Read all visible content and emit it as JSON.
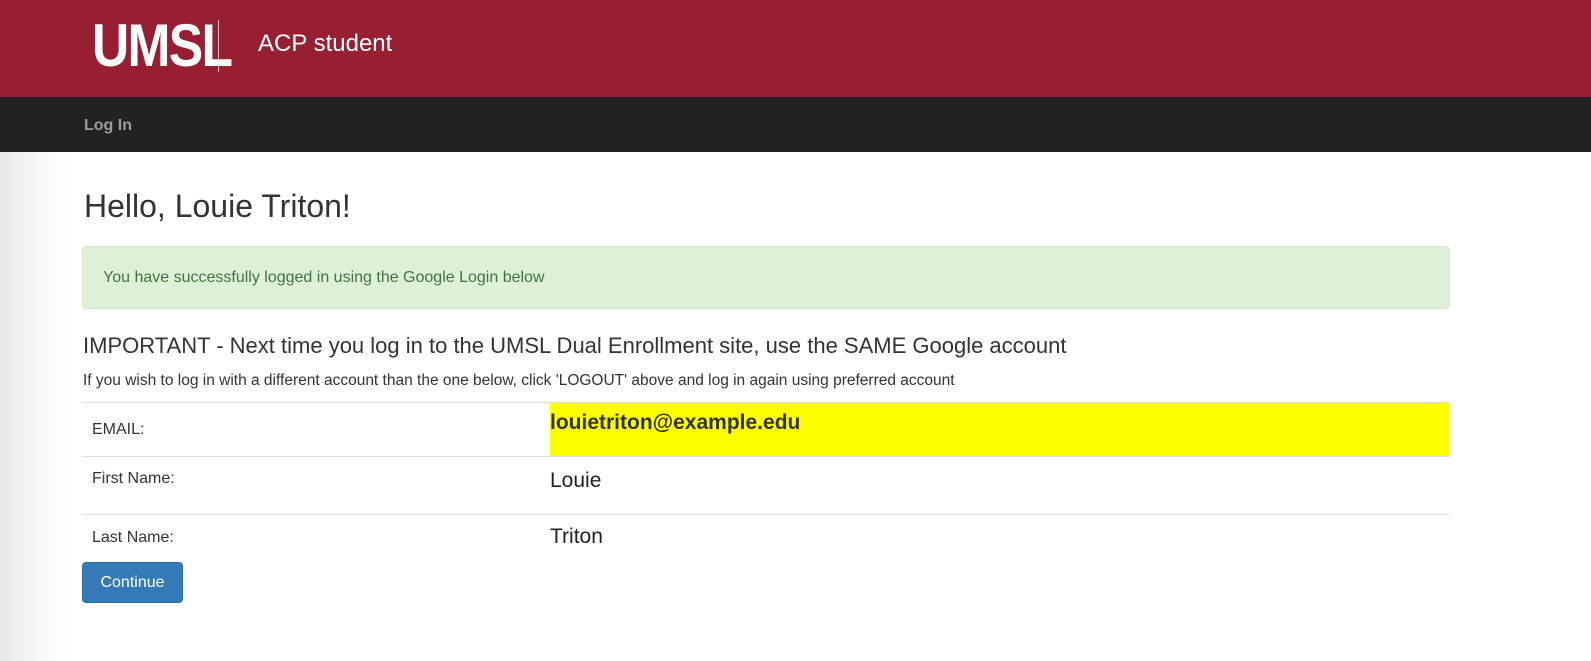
{
  "header": {
    "logo_text": "UMSL",
    "app_title": "ACP student",
    "background_color": "#981e32"
  },
  "navbar": {
    "login_label": "Log In",
    "background_color": "#222222"
  },
  "main": {
    "greeting": "Hello, Louie Triton!",
    "alert_message": "You have successfully logged in using the Google Login below",
    "important_heading": "IMPORTANT - Next time you log in to the UMSL Dual Enrollment site, use the SAME Google account",
    "instruction": "If you wish to log in with a different account than the one below, click 'LOGOUT' above and log in again using preferred account",
    "info_table": {
      "email_label": "EMAIL:",
      "email_value": "louietriton@example.edu",
      "first_name_label": "First Name:",
      "first_name_value": "Louie",
      "last_name_label": "Last Name:",
      "last_name_value": "Triton",
      "highlight_color": "#ffff00"
    },
    "continue_button_label": "Continue"
  }
}
